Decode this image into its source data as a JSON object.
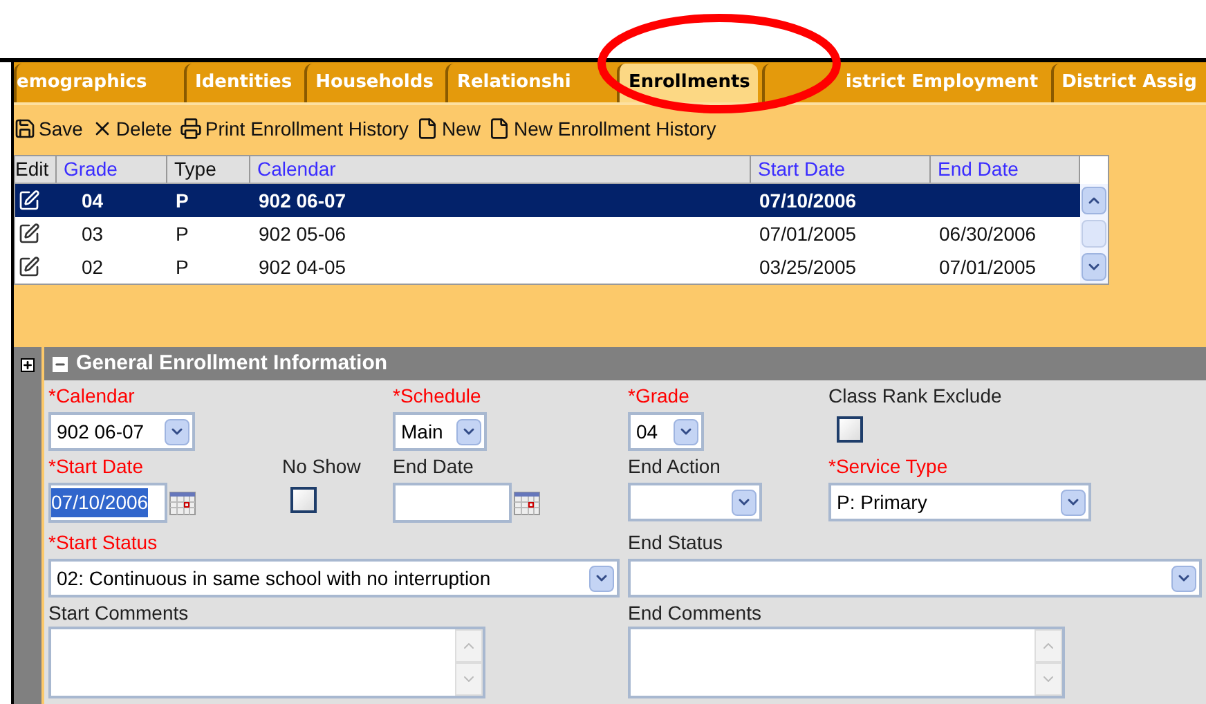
{
  "tabs": [
    {
      "label": "emographics",
      "selected": false
    },
    {
      "label": "Identities",
      "selected": false
    },
    {
      "label": "Households",
      "selected": false
    },
    {
      "label": "Relationshi",
      "selected": false
    },
    {
      "label": "Enrollments",
      "selected": true
    },
    {
      "label": "istrict Employment",
      "selected": false
    },
    {
      "label": "District Assig",
      "selected": false
    }
  ],
  "toolbar": [
    {
      "kind": "save",
      "label": "Save"
    },
    {
      "kind": "delete",
      "label": "Delete"
    },
    {
      "kind": "print",
      "label": "Print Enrollment History"
    },
    {
      "kind": "new",
      "label": "New"
    },
    {
      "kind": "new",
      "label": "New Enrollment History"
    }
  ],
  "table": {
    "columns": [
      {
        "label": "Edit",
        "sortable": false
      },
      {
        "label": "Grade",
        "sortable": true
      },
      {
        "label": "Type",
        "sortable": false
      },
      {
        "label": "Calendar",
        "sortable": true
      },
      {
        "label": "Start Date",
        "sortable": true
      },
      {
        "label": "End Date",
        "sortable": true
      }
    ],
    "rows": [
      {
        "selected": true,
        "cells": [
          "",
          "04",
          "P",
          "902 06-07",
          "07/10/2006",
          ""
        ]
      },
      {
        "selected": false,
        "cells": [
          "",
          "03",
          "P",
          "902 05-06",
          "07/01/2005",
          "06/30/2006"
        ]
      },
      {
        "selected": false,
        "cells": [
          "",
          "02",
          "P",
          "902 04-05",
          "03/25/2005",
          "07/01/2005"
        ]
      }
    ]
  },
  "section": {
    "title": "General Enrollment Information",
    "expanded": true,
    "fields": [
      {
        "kind": "select",
        "label": "*Calendar",
        "required": true,
        "value": "902 06-07"
      },
      {
        "kind": "select",
        "label": "*Schedule",
        "required": true,
        "value": "Main"
      },
      {
        "kind": "select",
        "label": "*Grade",
        "required": true,
        "value": "04"
      },
      {
        "kind": "checkbox",
        "label": "Class Rank Exclude",
        "required": false,
        "checked": false
      },
      {
        "kind": "date",
        "label": "*Start Date",
        "required": true,
        "value": "07/10/2006",
        "highlighted": true
      },
      {
        "kind": "checkbox",
        "label": "No Show",
        "required": false,
        "checked": false
      },
      {
        "kind": "date",
        "label": "End Date",
        "required": false
      },
      {
        "kind": "select",
        "label": "End Action",
        "required": false
      },
      {
        "kind": "select",
        "label": "*Service Type",
        "required": true,
        "value": "P: Primary"
      },
      {
        "kind": "select",
        "label": "*Start Status",
        "required": true,
        "value": "02: Continuous in same school with no interruption"
      },
      {
        "kind": "select",
        "label": "End Status",
        "required": false
      },
      {
        "kind": "textarea",
        "label": "Start Comments",
        "required": false
      },
      {
        "kind": "textarea",
        "label": "End Comments",
        "required": false
      }
    ]
  }
}
